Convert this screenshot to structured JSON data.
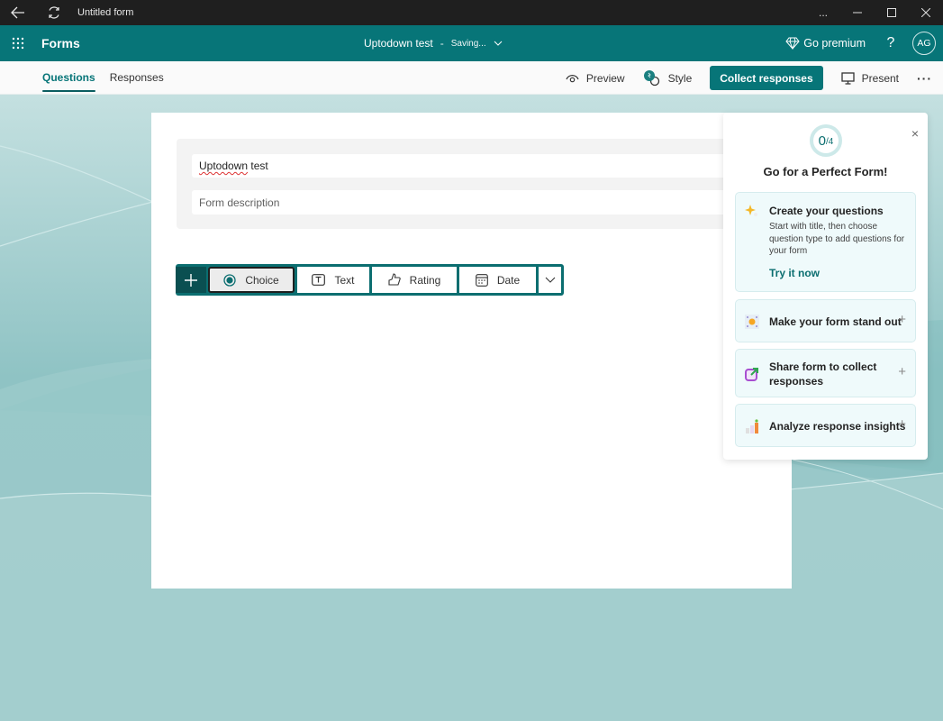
{
  "titlebar": {
    "back_icon": "back-arrow-icon",
    "refresh_icon": "sync-icon",
    "title": "Untitled form",
    "more_label": "...",
    "minimize_icon": "minimize-icon",
    "maximize_icon": "maximize-icon",
    "close_icon": "close-icon"
  },
  "appbar": {
    "app_launcher_icon": "waffle-icon",
    "app_name": "Forms",
    "document_title": "Uptodown test",
    "separator": "-",
    "save_status": "Saving...",
    "go_premium_label": "Go premium",
    "help_label": "?",
    "avatar_initials": "AG"
  },
  "commandbar": {
    "tabs": [
      {
        "label": "Questions",
        "active": true
      },
      {
        "label": "Responses",
        "active": false
      }
    ],
    "preview_label": "Preview",
    "style_label": "Style",
    "collect_label": "Collect responses",
    "present_label": "Present",
    "more_label": "···"
  },
  "form": {
    "title_value": "Uptodown test",
    "title_misspelled_word": "Uptodown",
    "title_rest": " test",
    "description_placeholder": "Form description"
  },
  "question_types": {
    "add_label": "+",
    "items": [
      {
        "label": "Choice",
        "icon": "radio-icon",
        "selected": true
      },
      {
        "label": "Text",
        "icon": "text-box-icon",
        "selected": false
      },
      {
        "label": "Rating",
        "icon": "thumb-icon",
        "selected": false
      },
      {
        "label": "Date",
        "icon": "calendar-icon",
        "selected": false
      }
    ],
    "more_icon": "chevron-down-icon"
  },
  "panel": {
    "progress_done": 0,
    "progress_total": 4,
    "progress_done_text": "0",
    "progress_total_text": "/4",
    "heading": "Go for a Perfect Form!",
    "close_label": "×",
    "steps": [
      {
        "title": "Create your questions",
        "description": "Start with title, then choose question type to add questions for your form",
        "link": "Try it now",
        "expanded": true
      },
      {
        "title": "Make your form stand out",
        "expanded": false,
        "plus": "+"
      },
      {
        "title": "Share form to collect responses",
        "expanded": false,
        "plus": "+"
      },
      {
        "title": "Analyze response insights",
        "expanded": false,
        "plus": "+"
      }
    ]
  },
  "colors": {
    "brand": "#077578",
    "brand_dark": "#0b6e70",
    "titlebar": "#1f1f1f"
  }
}
